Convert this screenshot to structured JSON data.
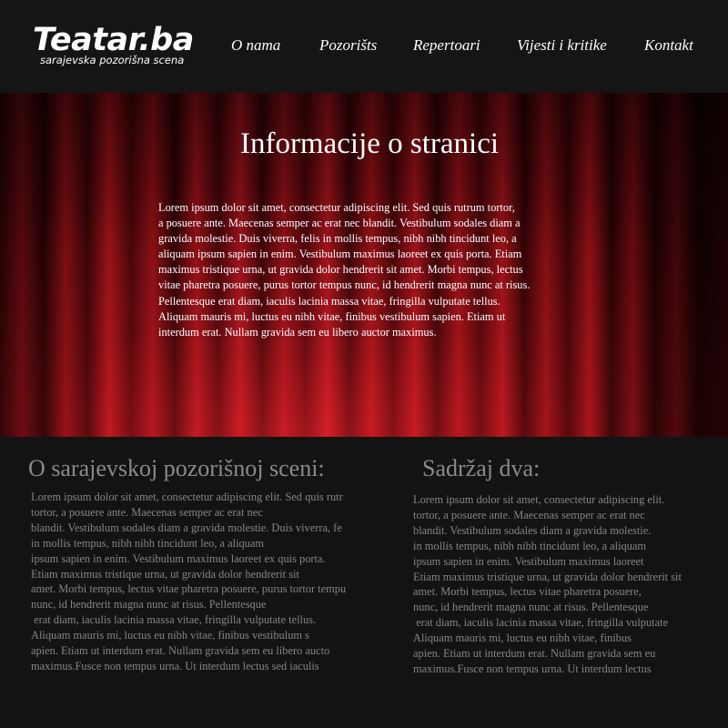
{
  "header": {
    "logo_title": "Teatar.ba",
    "logo_tagline": "sarajevska pozorišna scena",
    "nav": [
      {
        "label": "O nama"
      },
      {
        "label": "Pozorišts"
      },
      {
        "label": "Repertoari"
      },
      {
        "label": "Vijesti i kritike"
      },
      {
        "label": "Kontakt"
      }
    ]
  },
  "hero": {
    "title": "Informacije o stranici",
    "text": "Lorem ipsum dolor sit amet, consectetur adipiscing elit. Sed quis rutrum tortor,\na posuere ante. Maecenas semper ac erat nec blandit. Vestibulum sodales diam a\ngravida molestie. Duis viverra, felis in mollis tempus, nibh nibh tincidunt leo, a\n aliquam ipsum sapien in enim. Vestibulum maximus laoreet ex quis porta. Etiam\nmaximus tristique urna, ut gravida dolor hendrerit sit amet. Morbi tempus, lectus\nvitae pharetra posuere, purus tortor tempus nunc, id hendrerit magna nunc at risus.\nPellentesque erat diam, iaculis lacinia massa vitae, fringilla vulputate tellus.\nAliquam mauris mi, luctus eu nibh vitae, finibus vestibulum sapien. Etiam ut\ninterdum erat. Nullam gravida sem eu libero auctor maximus."
  },
  "left_column": {
    "heading": "O sarajevskoj pozorišnoj sceni:",
    "text": "Lorem ipsum dolor sit amet, consectetur adipiscing elit. Sed quis rutr\ntortor, a posuere ante. Maecenas semper ac erat nec\nblandit. Vestibulum sodales diam a gravida molestie. Duis viverra, fe\nin mollis tempus, nibh nibh tincidunt leo, a aliquam\nipsum sapien in enim. Vestibulum maximus laoreet ex quis porta.\nEtiam maximus tristique urna, ut gravida dolor hendrerit sit\namet. Morbi tempus, lectus vitae pharetra posuere, purus tortor tempu\nnunc, id hendrerit magna nunc at risus. Pellentesque\n erat diam, iaculis lacinia massa vitae, fringilla vulputate tellus.\nAliquam mauris mi, luctus eu nibh vitae, finibus vestibulum s\napien. Etiam ut interdum erat. Nullam gravida sem eu libero aucto\nmaximus.Fusce non tempus urna. Ut interdum lectus sed iaculis"
  },
  "right_column": {
    "heading": "Sadržaj dva:",
    "text": "Lorem ipsum dolor sit amet, consectetur adipiscing elit.\ntortor, a posuere ante. Maecenas semper ac erat nec\nblandit. Vestibulum sodales diam a gravida molestie.\nin mollis tempus, nibh nibh tincidunt leo, a aliquam\nipsum sapien in enim. Vestibulum maximus laoreet\nEtiam maximus tristique urna, ut gravida dolor hendrerit sit\namet. Morbi tempus, lectus vitae pharetra posuere,\nnunc, id hendrerit magna nunc at risus. Pellentesque\n erat diam, iaculis lacinia massa vitae, fringilla vulputate\nAliquam mauris mi, luctus eu nibh vitae, finibus\napien. Etiam ut interdum erat. Nullam gravida sem eu\nmaximus.Fusce non tempus urna. Ut interdum lectus"
  },
  "colors": {
    "header_bg": "#161516",
    "body_bg": "#141314",
    "curtain_red": "#b0141c",
    "curtain_dark": "#1a0203",
    "muted_text": "#858585",
    "heading_gray": "#8a8a8a"
  }
}
